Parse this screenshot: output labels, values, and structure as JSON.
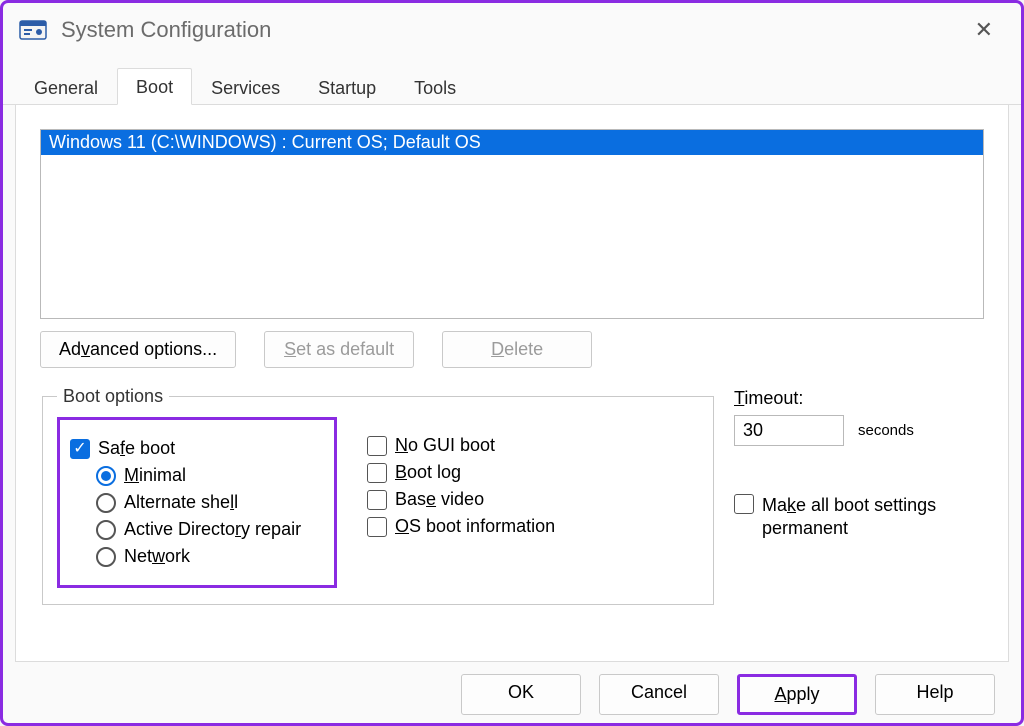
{
  "window": {
    "title": "System Configuration"
  },
  "tabs": [
    "General",
    "Boot",
    "Services",
    "Startup",
    "Tools"
  ],
  "active_tab": "Boot",
  "boot_list": {
    "selected": "Windows 11 (C:\\WINDOWS) : Current OS; Default OS"
  },
  "buttons_row": {
    "advanced": "Advanced options...",
    "set_default": "Set as default",
    "delete": "Delete"
  },
  "boot_options": {
    "legend": "Boot options",
    "safe_boot": {
      "label": "Safe boot",
      "checked": true
    },
    "safe_boot_modes": {
      "selected": "minimal",
      "minimal": "Minimal",
      "alt_shell": "Alternate shell",
      "ad_repair": "Active Directory repair",
      "network": "Network"
    },
    "flags": {
      "no_gui": {
        "label": "No GUI boot",
        "checked": false
      },
      "boot_log": {
        "label": "Boot log",
        "checked": false
      },
      "base_video": {
        "label": "Base video",
        "checked": false
      },
      "os_boot_info": {
        "label": "OS boot information",
        "checked": false
      }
    }
  },
  "timeout": {
    "label": "Timeout:",
    "value": "30",
    "unit": "seconds"
  },
  "make_permanent": {
    "label": "Make all boot settings permanent",
    "checked": false
  },
  "footer": {
    "ok": "OK",
    "cancel": "Cancel",
    "apply": "Apply",
    "help": "Help"
  }
}
